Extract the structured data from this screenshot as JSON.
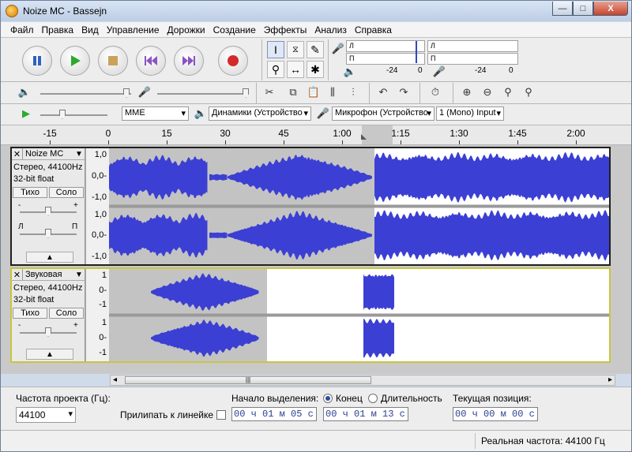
{
  "window": {
    "title": "Noize MC - Bassejn",
    "min_symbol": "—",
    "max_symbol": "□",
    "close_symbol": "X"
  },
  "menu": [
    "Файл",
    "Правка",
    "Вид",
    "Управление",
    "Дорожки",
    "Создание",
    "Эффекты",
    "Анализ",
    "Справка"
  ],
  "meters": {
    "l": "Л",
    "r": "П",
    "tick_minus24": "-24",
    "tick_zero": "0"
  },
  "devices": {
    "host": "MME",
    "playback": "Динамики (Устройство",
    "recording": "Микрофон (Устройство",
    "channels": "1 (Mono) Input"
  },
  "ruler": {
    "labels": [
      "-15",
      "0",
      "15",
      "30",
      "45",
      "1:00",
      "1:15",
      "1:30",
      "1:45",
      "2:00"
    ]
  },
  "tracks": [
    {
      "name": "Noize MC",
      "info1": "Стерео, 44100Hz",
      "info2": "32-bit float",
      "mute": "Тихо",
      "solo": "Соло",
      "scale": [
        "1,0",
        "0,0-",
        "-1,0"
      ],
      "gain_minus": "-",
      "gain_plus": "+",
      "pan_l": "Л",
      "pan_r": "П"
    },
    {
      "name": "Звуковая",
      "info1": "Стерео, 44100Hz",
      "info2": "32-bit float",
      "mute": "Тихо",
      "solo": "Соло",
      "scale": [
        "1",
        "0-",
        "-1"
      ],
      "gain_minus": "-",
      "gain_plus": "+"
    }
  ],
  "bottom": {
    "rate_label": "Частота проекта (Гц):",
    "rate_value": "44100",
    "snap_label": "Прилипать к линейке",
    "selection_label": "Начало выделения:",
    "end_label": "Конец",
    "length_label": "Длительность",
    "position_label": "Текущая позиция:",
    "sel_start": "00 ч 01 м 05 с",
    "sel_end": "00 ч 01 м 13 с",
    "position": "00 ч 00 м 00 с"
  },
  "status": {
    "actual_rate": "Реальная частота: 44100 Гц"
  },
  "colors": {
    "wave": "#3c3fd3",
    "wave_dark": "#2c2fb8",
    "selection": "#9f9f9f",
    "accent": "#2c4c9d"
  }
}
